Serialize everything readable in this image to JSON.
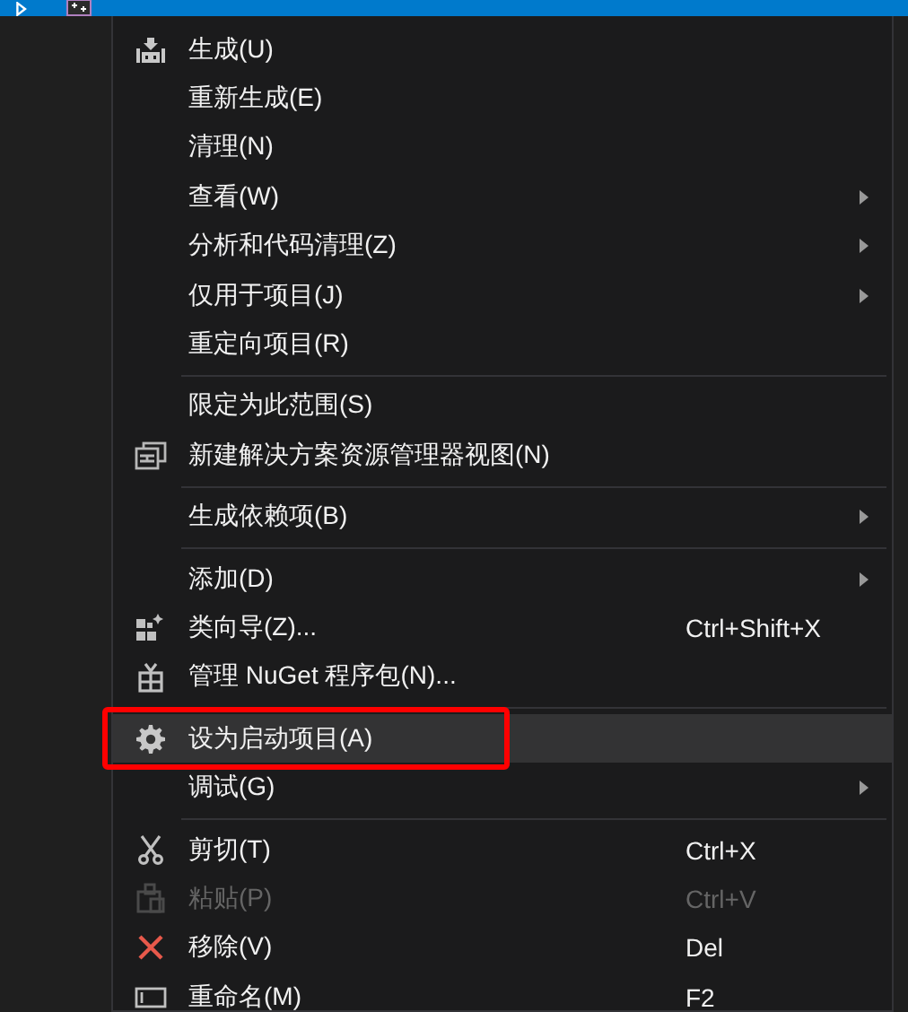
{
  "tree_row": {
    "selected": true
  },
  "menu": [
    {
      "kind": "item",
      "label": "生成(U)",
      "submenu": false,
      "disabled": false,
      "selected": false
    },
    {
      "kind": "item",
      "label": "重新生成(E)",
      "submenu": false,
      "disabled": false,
      "selected": false
    },
    {
      "kind": "item",
      "label": "清理(N)",
      "submenu": false,
      "disabled": false,
      "selected": false
    },
    {
      "kind": "item",
      "label": "查看(W)",
      "submenu": true,
      "disabled": false,
      "selected": false
    },
    {
      "kind": "item",
      "label": "分析和代码清理(Z)",
      "submenu": true,
      "disabled": false,
      "selected": false
    },
    {
      "kind": "item",
      "label": "仅用于项目(J)",
      "submenu": true,
      "disabled": false,
      "selected": false
    },
    {
      "kind": "item",
      "label": "重定向项目(R)",
      "submenu": false,
      "disabled": false,
      "selected": false
    },
    {
      "kind": "separator"
    },
    {
      "kind": "item",
      "label": "限定为此范围(S)",
      "submenu": false,
      "disabled": false,
      "selected": false
    },
    {
      "kind": "item",
      "label": "新建解决方案资源管理器视图(N)",
      "submenu": false,
      "disabled": false,
      "selected": false
    },
    {
      "kind": "separator"
    },
    {
      "kind": "item",
      "label": "生成依赖项(B)",
      "submenu": true,
      "disabled": false,
      "selected": false
    },
    {
      "kind": "separator"
    },
    {
      "kind": "item",
      "label": "添加(D)",
      "submenu": true,
      "disabled": false,
      "selected": false
    },
    {
      "kind": "item",
      "label": "类向导(Z)...",
      "shortcut": "Ctrl+Shift+X",
      "submenu": false,
      "disabled": false,
      "selected": false
    },
    {
      "kind": "item",
      "label": "管理 NuGet 程序包(N)...",
      "submenu": false,
      "disabled": false,
      "selected": false
    },
    {
      "kind": "separator"
    },
    {
      "kind": "item",
      "label": "设为启动项目(A)",
      "submenu": false,
      "disabled": false,
      "selected": true,
      "outlined": true
    },
    {
      "kind": "item",
      "label": "调试(G)",
      "submenu": true,
      "disabled": false,
      "selected": false
    },
    {
      "kind": "separator"
    },
    {
      "kind": "item",
      "label": "剪切(T)",
      "shortcut": "Ctrl+X",
      "submenu": false,
      "disabled": false,
      "selected": false
    },
    {
      "kind": "item",
      "label": "粘贴(P)",
      "shortcut": "Ctrl+V",
      "submenu": false,
      "disabled": true,
      "selected": false
    },
    {
      "kind": "item",
      "label": "移除(V)",
      "shortcut": "Del",
      "submenu": false,
      "disabled": false,
      "selected": false
    },
    {
      "kind": "item",
      "label": "重命名(M)",
      "shortcut": "F2",
      "submenu": false,
      "disabled": false,
      "selected": false
    }
  ]
}
